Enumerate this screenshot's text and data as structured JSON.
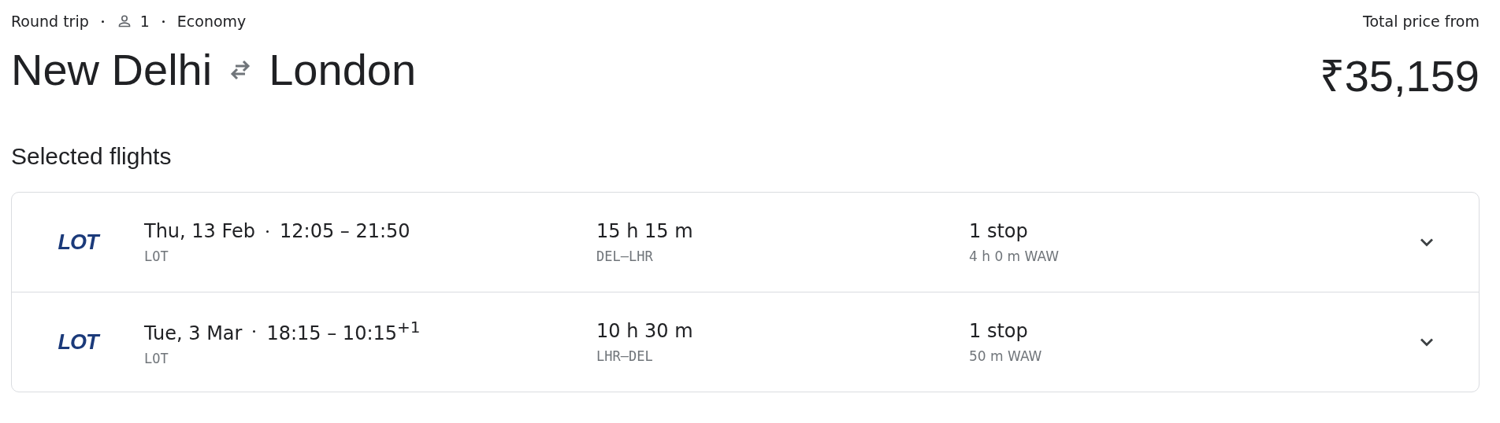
{
  "trip": {
    "type": "Round trip",
    "passengers": "1",
    "cabin": "Economy"
  },
  "route": {
    "origin": "New Delhi",
    "destination": "London"
  },
  "price": {
    "label": "Total price from",
    "amount": "₹35,159"
  },
  "section_title": "Selected flights",
  "flights": [
    {
      "logo": "LOT",
      "date": "Thu, 13 Feb",
      "times": "12:05 – 21:50",
      "airline": "LOT",
      "duration": "15 h 15 m",
      "route": "DEL–LHR",
      "stops": "1 stop",
      "layover": "4 h 0 m WAW",
      "expanded": false
    },
    {
      "logo": "LOT",
      "date": "Tue, 3 Mar",
      "times": "18:15 – 10:15$^{+1}$",
      "airline": "LOT",
      "duration": "10 h 30 m",
      "route": "LHR–DEL",
      "stops": "1 stop",
      "layover": "50 m WAW",
      "expanded": false
    }
  ]
}
